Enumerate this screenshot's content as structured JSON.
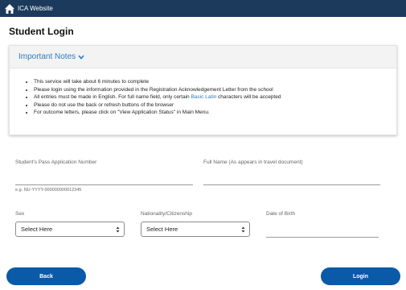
{
  "header": {
    "site_title": "ICA Website"
  },
  "page_title": "Student Login",
  "notes": {
    "title": "Important Notes",
    "items": [
      "This service will take about 6 minutes to complete",
      "Please login using the information provided in the Registration Acknowledgement Letter from the school",
      "Please do not use the back or refresh buttons of the browser",
      "For outcome letters, please click on \"View Application Status\" in Main Menu."
    ],
    "entries_item": {
      "before": "All entries must be made in English. For full name field, only certain ",
      "link": "Basic Latin",
      "after": " characters will be accepted"
    }
  },
  "form": {
    "pass_number_label": "Student's Pass Application Number",
    "pass_number_value": "",
    "pass_number_hint": "e.g. NU-YYYY-000000000012345",
    "full_name_label": "Full Name (As appears in travel document)",
    "full_name_value": "",
    "sex_label": "Sex",
    "sex_selected": "Select Here",
    "nationality_label": "Nationality/Citizenship",
    "nationality_selected": "Select Here",
    "dob_label": "Date of Birth",
    "dob_value": ""
  },
  "buttons": {
    "back": "Back",
    "login": "Login"
  },
  "colors": {
    "header_bg": "#1b3a5c",
    "accent": "#2a7bc4",
    "button_bg": "#0a5aa8"
  },
  "icons": {
    "home": "home-icon",
    "notes_toggle": "chevron-down-icon",
    "select": "select-arrows-icon"
  }
}
